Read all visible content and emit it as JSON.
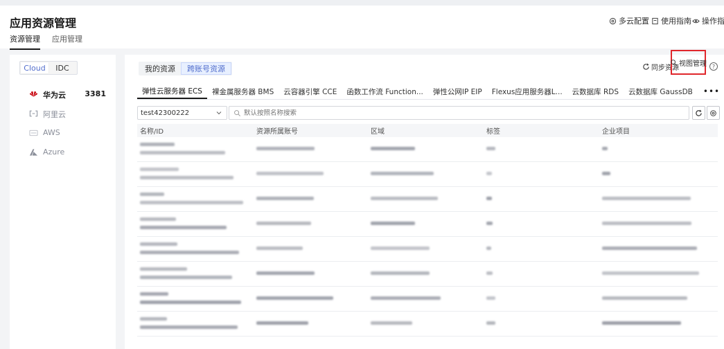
{
  "header": {
    "title": "应用资源管理",
    "tabs": [
      {
        "label": "资源管理",
        "active": true
      },
      {
        "label": "应用管理",
        "active": false
      }
    ],
    "links": [
      {
        "label": "多云配置",
        "icon": "cloud-config-icon"
      },
      {
        "label": "使用指南",
        "icon": "guide-icon"
      },
      {
        "label": "操作指引",
        "icon": "operation-guide-icon"
      }
    ]
  },
  "left_panel": {
    "segment": [
      {
        "label": "Cloud",
        "active": true
      },
      {
        "label": "IDC",
        "active": false
      }
    ],
    "clouds": [
      {
        "name": "华为云",
        "count": "3381",
        "icon": "huawei-cloud-icon",
        "active": true
      },
      {
        "name": "阿里云",
        "count": "",
        "icon": "aliyun-icon",
        "active": false
      },
      {
        "name": "AWS",
        "count": "",
        "icon": "aws-icon",
        "active": false
      },
      {
        "name": "Azure",
        "count": "",
        "icon": "azure-icon",
        "active": false
      }
    ]
  },
  "content": {
    "resource_tabs": [
      {
        "label": "我的资源",
        "active": false
      },
      {
        "label": "跨账号资源",
        "active": true
      }
    ],
    "sync_label": "同步资源",
    "view_manage_label": "视图管理",
    "help_label": "?",
    "service_tabs": [
      {
        "label": "弹性云服务器 ECS",
        "active": true
      },
      {
        "label": "裸金属服务器 BMS",
        "active": false
      },
      {
        "label": "云容器引擎 CCE",
        "active": false
      },
      {
        "label": "函数工作流 Function...",
        "active": false
      },
      {
        "label": "弹性公网IP EIP",
        "active": false
      },
      {
        "label": "Flexus应用服务器L...",
        "active": false
      },
      {
        "label": "云数据库 RDS",
        "active": false
      },
      {
        "label": "云数据库 GaussDB",
        "active": false
      }
    ],
    "more_label": "•••",
    "account_select": {
      "value": "test42300222"
    },
    "search": {
      "placeholder": "默认按照名称搜索"
    },
    "table": {
      "columns": [
        "名称/ID",
        "资源所属账号",
        "区域",
        "标签",
        "企业项目"
      ],
      "row_count": 8
    }
  },
  "colors": {
    "accent": "#526ecc",
    "highlight_box": "#e0262b",
    "huawei_red": "#c7000b"
  }
}
